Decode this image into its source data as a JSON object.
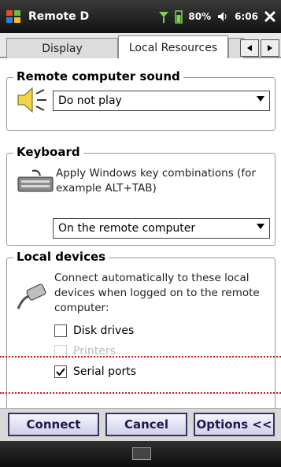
{
  "titlebar": {
    "app_name": "Remote D",
    "battery": "80%",
    "time": "6:06",
    "icons": [
      "start-flag-icon",
      "signal-icon",
      "battery-icon",
      "volume-icon",
      "close-icon"
    ]
  },
  "tabs": [
    {
      "label": "Display",
      "active": false
    },
    {
      "label": "Local Resources",
      "active": true
    }
  ],
  "sound": {
    "group_title": "Remote computer sound",
    "select_value": "Do not play",
    "icon": "speaker-icon"
  },
  "keyboard": {
    "group_title": "Keyboard",
    "description": "Apply Windows key combinations (for example ALT+TAB)",
    "select_value": "On the remote computer",
    "icon": "keyboard-icon"
  },
  "devices": {
    "group_title": "Local devices",
    "description": "Connect automatically to these local devices when logged on to the remote computer:",
    "icon": "plug-icon",
    "items": [
      {
        "label": "Disk drives",
        "checked": false,
        "enabled": true
      },
      {
        "label": "Printers",
        "checked": false,
        "enabled": false
      },
      {
        "label": "Serial ports",
        "checked": true,
        "enabled": true
      }
    ]
  },
  "buttons": {
    "connect": "Connect",
    "cancel": "Cancel",
    "options": "Options <<"
  },
  "colors": {
    "annotation_line": "#d01818",
    "button_border": "#35355a"
  }
}
